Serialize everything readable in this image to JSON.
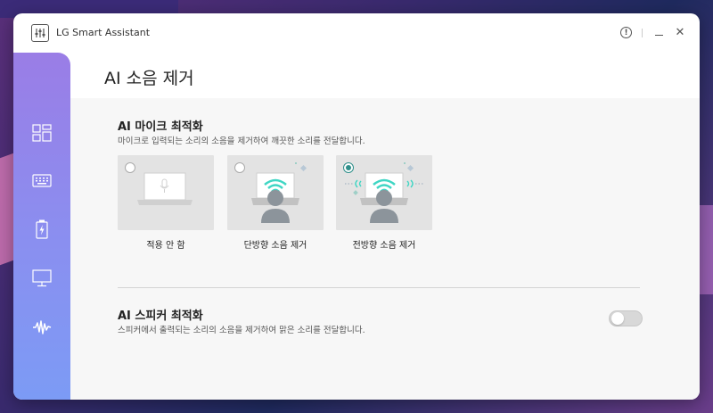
{
  "app": {
    "title": "LG Smart Assistant",
    "info_icon": "info-icon",
    "minimize_icon": "minimize-icon",
    "close_icon": "close-icon",
    "close_glyph": "✕",
    "info_glyph": "!"
  },
  "sidebar": {
    "items": [
      {
        "name": "dashboard",
        "icon": "dashboard-icon"
      },
      {
        "name": "keyboard",
        "icon": "keyboard-icon"
      },
      {
        "name": "battery",
        "icon": "battery-icon"
      },
      {
        "name": "display",
        "icon": "monitor-icon"
      },
      {
        "name": "audio",
        "icon": "waveform-icon",
        "active": true
      }
    ],
    "colors": {
      "top": "#9a7de6",
      "bottom": "#7c9bf5"
    }
  },
  "page": {
    "title": "AI 소음 제거"
  },
  "mic": {
    "title": "AI 마이크 최적화",
    "description": "마이크로 입력되는 소리의 소음을 제거하여 깨끗한 소리를 전달합니다.",
    "options": [
      {
        "label": "적용 안 함",
        "selected": false,
        "icon": "laptop-mic-icon"
      },
      {
        "label": "단방향 소음 제거",
        "selected": false,
        "icon": "user-laptop-wave-icon"
      },
      {
        "label": "전방향 소음 제거",
        "selected": true,
        "icon": "user-laptop-omni-wave-icon"
      }
    ],
    "accent": "#2f8f8a",
    "wave_color": "#3fd6c4"
  },
  "speaker": {
    "title": "AI 스피커 최적화",
    "description": "스피커에서 출력되는 소리의 소음을 제거하여 맑은 소리를 전달합니다.",
    "toggle_on": false
  }
}
